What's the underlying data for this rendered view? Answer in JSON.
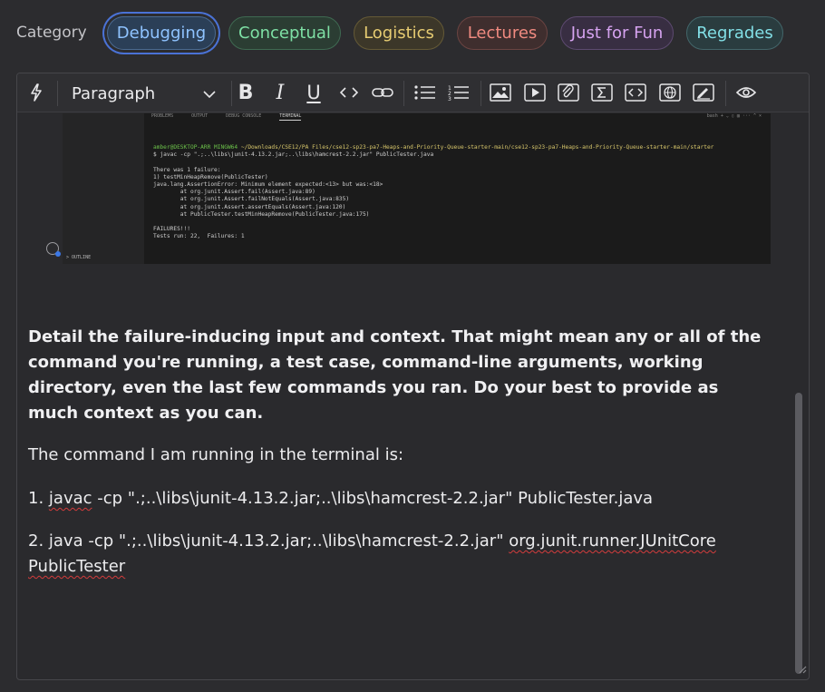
{
  "category": {
    "label": "Category",
    "chips": [
      {
        "label": "Debugging",
        "selected": true,
        "text_color": "#8fc3ff",
        "bg": "#2b3f57",
        "border": "#4a6a91"
      },
      {
        "label": "Conceptual",
        "selected": false,
        "text_color": "#7ee0a5",
        "bg": "#2b3d33",
        "border": "#3f6a52"
      },
      {
        "label": "Logistics",
        "selected": false,
        "text_color": "#e7cc72",
        "bg": "#3c3729",
        "border": "#655a36"
      },
      {
        "label": "Lectures",
        "selected": false,
        "text_color": "#f08a80",
        "bg": "#3f2e2e",
        "border": "#6b4442"
      },
      {
        "label": "Just for Fun",
        "selected": false,
        "text_color": "#d6a3f0",
        "bg": "#382e42",
        "border": "#5d4a70"
      },
      {
        "label": "Regrades",
        "selected": false,
        "text_color": "#82dfe6",
        "bg": "#2a3c3f",
        "border": "#43666a"
      }
    ]
  },
  "toolbar": {
    "format_value": "Paragraph",
    "icons": [
      "lightning-icon",
      "bold-icon",
      "italic-icon",
      "underline-icon",
      "inline-code-icon",
      "link-icon",
      "bullet-list-icon",
      "numbered-list-icon",
      "image-icon",
      "video-icon",
      "attachment-icon",
      "math-icon",
      "code-block-icon",
      "web-embed-icon",
      "drawing-icon",
      "preview-eye-icon"
    ]
  },
  "screenshot": {
    "tabs": [
      "PROBLEMS",
      "OUTPUT",
      "DEBUG CONSOLE",
      "TERMINAL"
    ],
    "right_controls": "bash  +  ⌄  ▯  ▥  ···  ^  ×",
    "outline_label": "> OUTLINE",
    "prompt_user": "amber@DESKTOP-ARR MINGW64",
    "prompt_path": "~/Downloads/CSE12/PA Files/cse12-sp23-pa7-Heaps-and-Priority-Queue-starter-main/cse12-sp23-pa7-Heaps-and-Priority-Queue-starter-main/starter",
    "command_line": "$ javac -cp \".;..\\libs\\junit-4.13.2.jar;..\\libs\\hamcrest-2.2.jar\" PublicTester.java",
    "output_lines": [
      "There was 1 failure:",
      "1) testMinHeapRemove(PublicTester)",
      "java.lang.AssertionError: Minimum element expected:<13> but was:<18>",
      "        at org.junit.Assert.fail(Assert.java:89)",
      "        at org.junit.Assert.failNotEquals(Assert.java:835)",
      "        at org.junit.Assert.assertEquals(Assert.java:120)",
      "        at PublicTester.testMinHeapRemove(PublicTester.java:175)",
      "",
      "FAILURES!!!",
      "Tests run: 22,  Failures: 1"
    ]
  },
  "content": {
    "prompt": "Detail the failure-inducing input and context. That might mean any or all of the command you're running, a test case, command-line arguments, working directory, even the last few commands you ran. Do your best to provide as much context as you can.",
    "intro": "The command I am running in the terminal is:",
    "cmd1": {
      "number": "1. ",
      "word": "javac",
      "rest": " -cp \".;..\\libs\\junit-4.13.2.jar;..\\libs\\hamcrest-2.2.jar\" PublicTester.java"
    },
    "cmd2": {
      "prefix": "2. java -cp \".;..\\libs\\junit-4.13.2.jar;..\\libs\\hamcrest-2.2.jar\" ",
      "class_name": "org.junit.runner.JUnitCore",
      "space": " ",
      "arg": "PublicTester"
    }
  }
}
